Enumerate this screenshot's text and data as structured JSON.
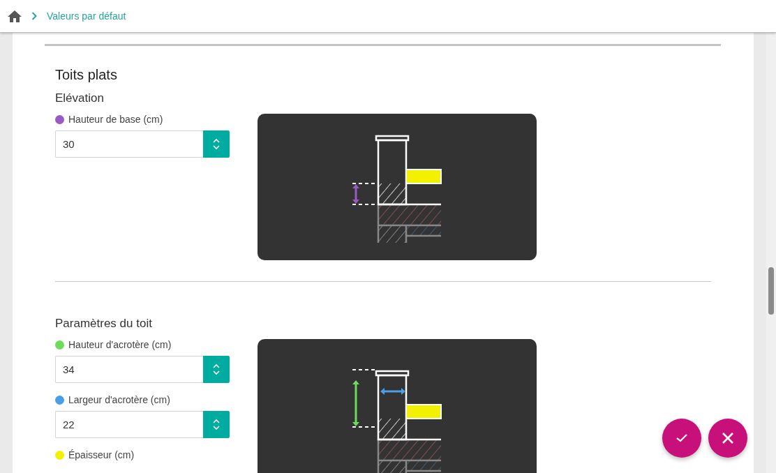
{
  "breadcrumb": {
    "items": [
      {
        "label": "Valeurs par défaut"
      }
    ]
  },
  "title": "Toits plats",
  "sections": [
    {
      "heading": "Elévation",
      "fields": [
        {
          "label": "Hauteur de base (cm)",
          "value": "30",
          "color": "#9b59c6",
          "kind": "base-height"
        }
      ]
    },
    {
      "heading": "Paramètres du toit",
      "fields": [
        {
          "label": "Hauteur d'acrotère (cm)",
          "value": "34",
          "color": "#6ddc5c",
          "kind": "parapet-height"
        },
        {
          "label": "Largeur d'acrotère (cm)",
          "value": "22",
          "color": "#4a9fe6",
          "kind": "parapet-width"
        },
        {
          "label": "Épaisseur (cm)",
          "color": "#f2f200",
          "kind": "thickness"
        }
      ]
    }
  ],
  "actions": [
    {
      "kind": "confirm"
    },
    {
      "kind": "cancel"
    }
  ]
}
